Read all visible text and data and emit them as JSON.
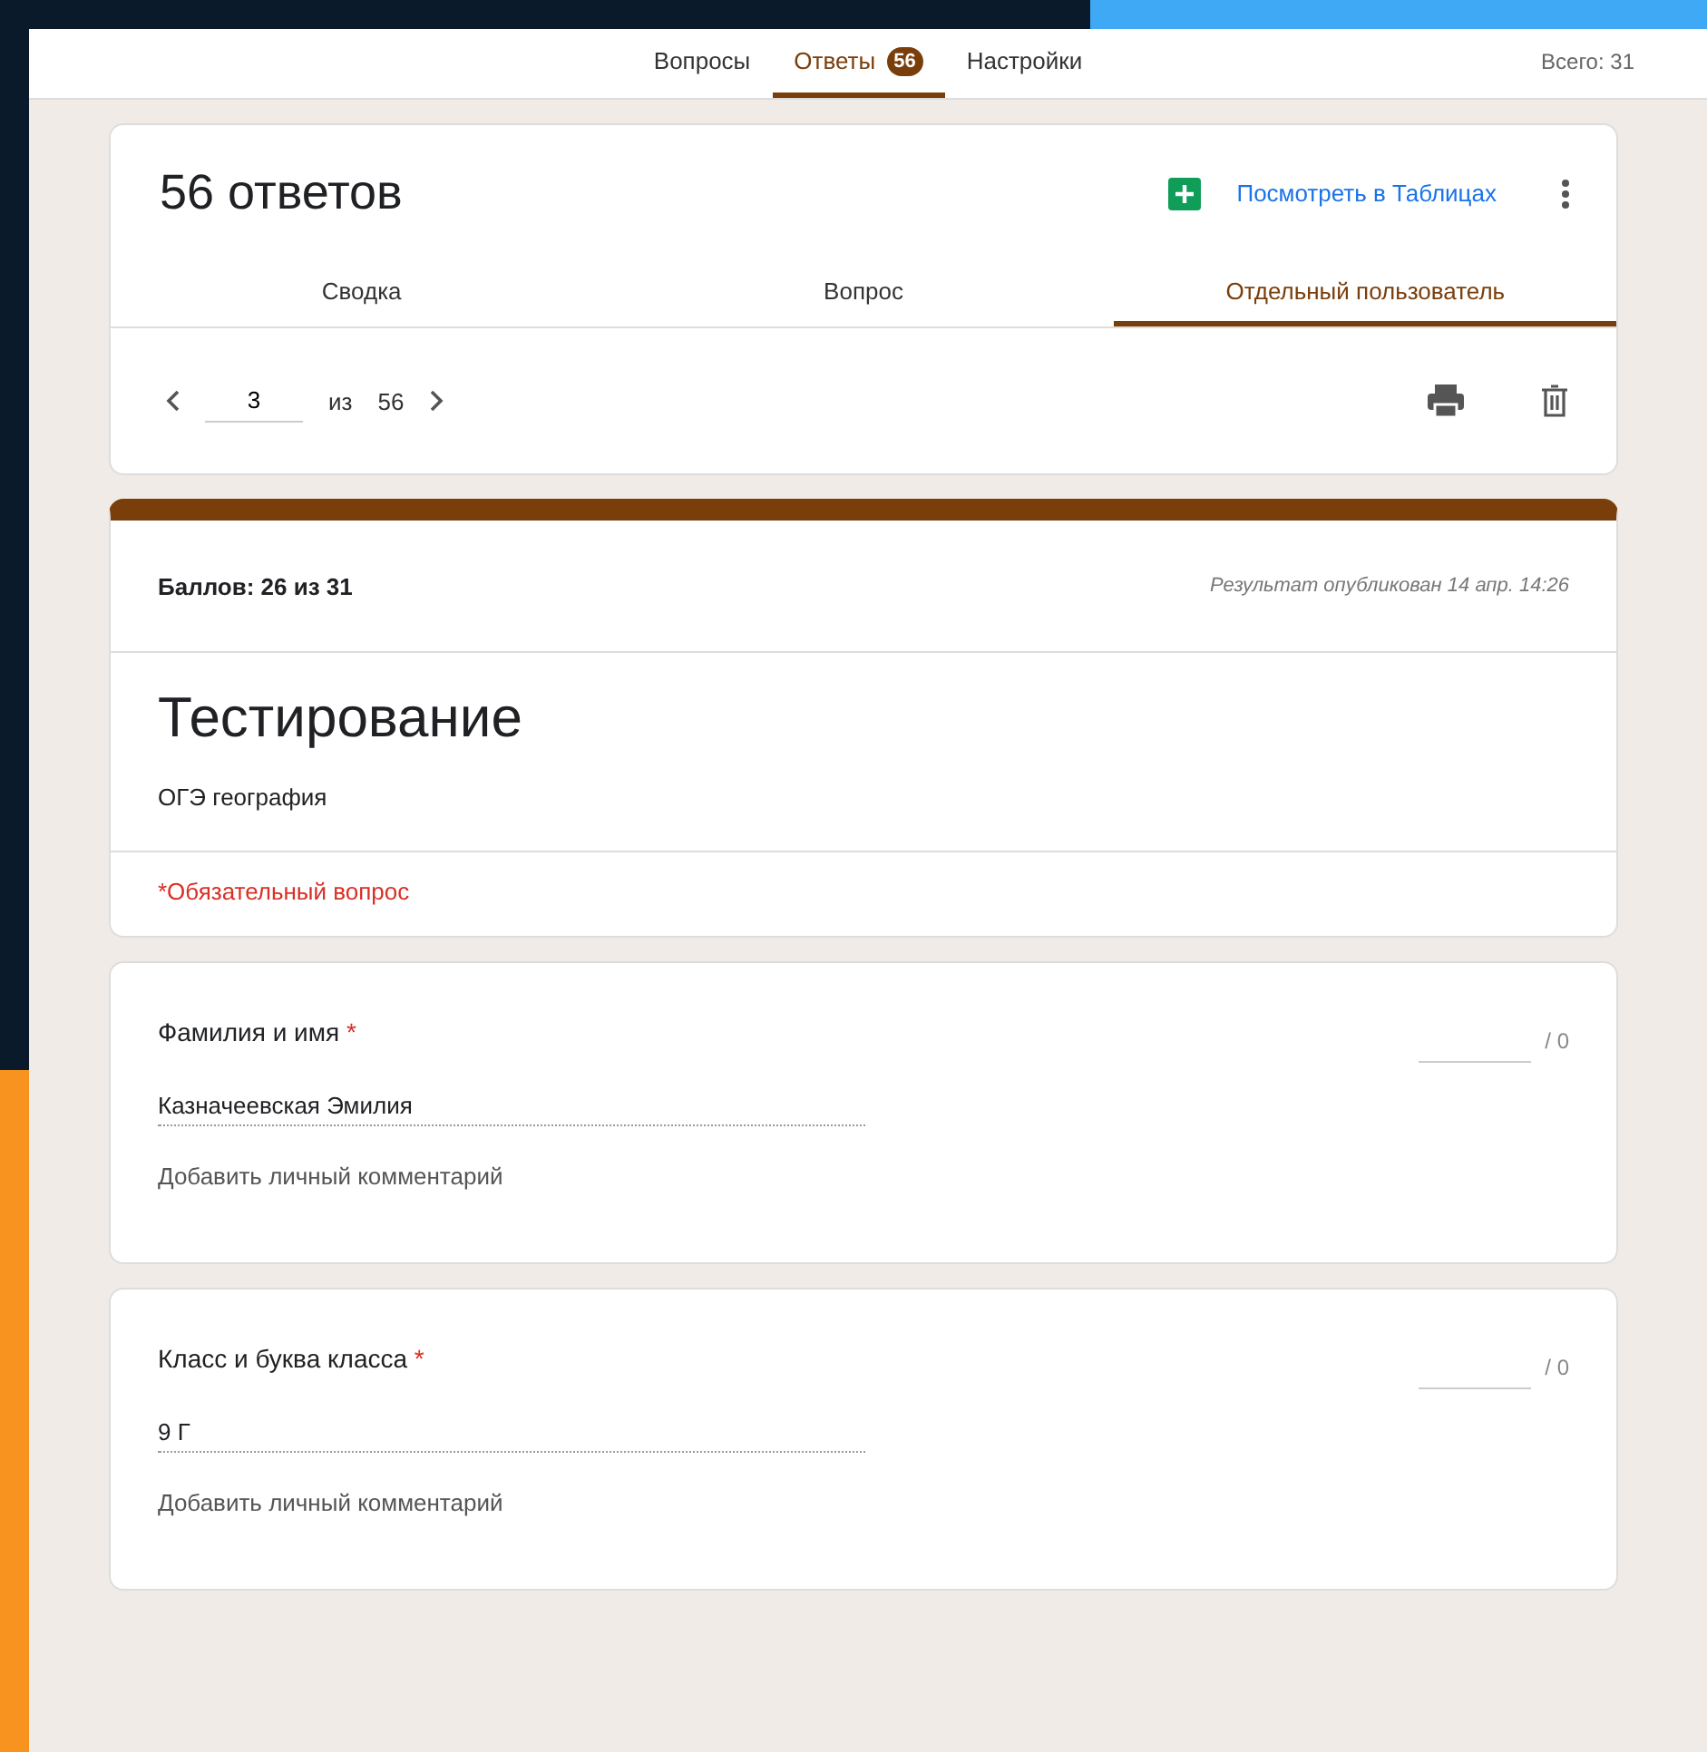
{
  "top_tabs": [
    {
      "label": "Вопросы",
      "selected": false
    },
    {
      "label": "Ответы",
      "selected": true,
      "badge": "56"
    },
    {
      "label": "Настройки",
      "selected": false
    }
  ],
  "total": "Всего: 31",
  "responses_card": {
    "title": "56 ответов",
    "sheets_link": "Посмотреть в Таблицах",
    "tabs": [
      {
        "label": "Сводка",
        "selected": false
      },
      {
        "label": "Вопрос",
        "selected": false
      },
      {
        "label": "Отдельный пользователь",
        "selected": true
      }
    ],
    "pager": {
      "value": "3",
      "of": "из",
      "total": "56"
    }
  },
  "result_card": {
    "score": "Баллов: 26 из 31",
    "published": "Результат опубликован 14 апр. 14:26",
    "title": "Тестирование",
    "description": "ОГЭ география",
    "required_note": "*Обязательный вопрос"
  },
  "questions": [
    {
      "title": "Фамилия и имя",
      "required": true,
      "required_mark": "*",
      "answer": "Казначеевская Эмилия",
      "max_points": "/ 0",
      "comment": "Добавить личный комментарий"
    },
    {
      "title": "Класс и буква класса",
      "required": true,
      "required_mark": "*",
      "answer": "9 Г",
      "max_points": "/ 0",
      "comment": "Добавить личный комментарий"
    }
  ]
}
